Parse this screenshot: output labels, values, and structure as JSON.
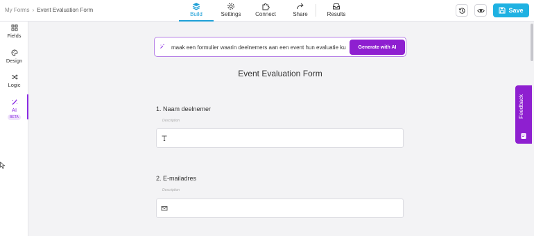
{
  "breadcrumb": {
    "root": "My Forms",
    "separator": "›",
    "current": "Event Evaluation Form"
  },
  "nav": {
    "tabs": [
      {
        "label": "Build",
        "icon": "stack-icon",
        "active": true
      },
      {
        "label": "Settings",
        "icon": "gear-icon",
        "active": false
      },
      {
        "label": "Connect",
        "icon": "puzzle-icon",
        "active": false
      },
      {
        "label": "Share",
        "icon": "share-arrow-icon",
        "active": false
      }
    ],
    "results": {
      "label": "Results",
      "icon": "inbox-icon"
    }
  },
  "toolbar": {
    "save_label": "Save",
    "accent": "#1eb1e2"
  },
  "sidebar": {
    "items": [
      {
        "label": "Fields",
        "icon": "grid-icon"
      },
      {
        "label": "Design",
        "icon": "palette-icon"
      },
      {
        "label": "Logic",
        "icon": "shuffle-icon"
      },
      {
        "label": "AI",
        "icon": "magic-wand-icon",
        "badge": "BETA",
        "active": true
      }
    ],
    "accent": "#8a2be2"
  },
  "ai": {
    "prompt_value": "maak een formulier waarin deelnemers aan een event hun evaluatie ku",
    "button_label": "Generate with AI"
  },
  "form": {
    "title": "Event Evaluation Form",
    "questions": [
      {
        "label": "1. Naam deelnemer",
        "description": "Description",
        "icon": "text-t-icon"
      },
      {
        "label": "2. E-mailadres",
        "description": "Description",
        "icon": "envelope-icon"
      }
    ]
  },
  "feedback": {
    "label": "Feedback"
  }
}
